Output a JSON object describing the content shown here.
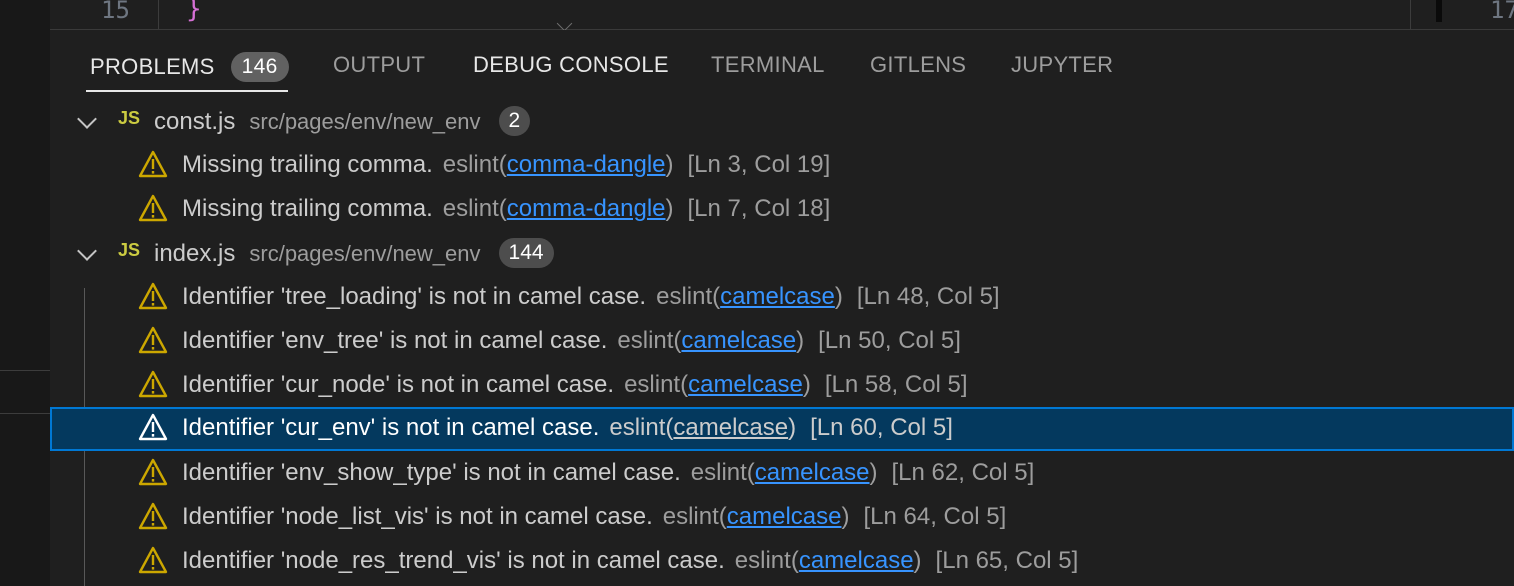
{
  "editor": {
    "line_number_left": "15",
    "code_text": "}",
    "line_number_right": "17"
  },
  "tabs": [
    {
      "label": "PROBLEMS",
      "count": "146"
    },
    {
      "label": "OUTPUT"
    },
    {
      "label": "DEBUG CONSOLE"
    },
    {
      "label": "TERMINAL"
    },
    {
      "label": "GITLENS"
    },
    {
      "label": "JUPYTER"
    }
  ],
  "files": [
    {
      "icon": "JS",
      "name": "const.js",
      "path": "src/pages/env/new_env",
      "count": "2",
      "problems": [
        {
          "message": "Missing trailing comma.",
          "source": "eslint",
          "code": "comma-dangle",
          "location": "[Ln 3, Col 19]"
        },
        {
          "message": "Missing trailing comma.",
          "source": "eslint",
          "code": "comma-dangle",
          "location": "[Ln 7, Col 18]"
        }
      ]
    },
    {
      "icon": "JS",
      "name": "index.js",
      "path": "src/pages/env/new_env",
      "count": "144",
      "problems": [
        {
          "message": "Identifier 'tree_loading' is not in camel case.",
          "source": "eslint",
          "code": "camelcase",
          "location": "[Ln 48, Col 5]"
        },
        {
          "message": "Identifier 'env_tree' is not in camel case.",
          "source": "eslint",
          "code": "camelcase",
          "location": "[Ln 50, Col 5]"
        },
        {
          "message": "Identifier 'cur_node' is not in camel case.",
          "source": "eslint",
          "code": "camelcase",
          "location": "[Ln 58, Col 5]"
        },
        {
          "message": "Identifier 'cur_env' is not in camel case.",
          "source": "eslint",
          "code": "camelcase",
          "location": "[Ln 60, Col 5]"
        },
        {
          "message": "Identifier 'env_show_type' is not in camel case.",
          "source": "eslint",
          "code": "camelcase",
          "location": "[Ln 62, Col 5]"
        },
        {
          "message": "Identifier 'node_list_vis' is not in camel case.",
          "source": "eslint",
          "code": "camelcase",
          "location": "[Ln 64, Col 5]"
        },
        {
          "message": "Identifier 'node_res_trend_vis' is not in camel case.",
          "source": "eslint",
          "code": "camelcase",
          "location": "[Ln 65, Col 5]"
        }
      ]
    }
  ],
  "colors": {
    "background": "#1f1f1f",
    "warning": "#cca700",
    "link": "#3794ff",
    "selection": "#04395e",
    "focus_border": "#0078d4",
    "js_icon": "#cbcb41"
  }
}
